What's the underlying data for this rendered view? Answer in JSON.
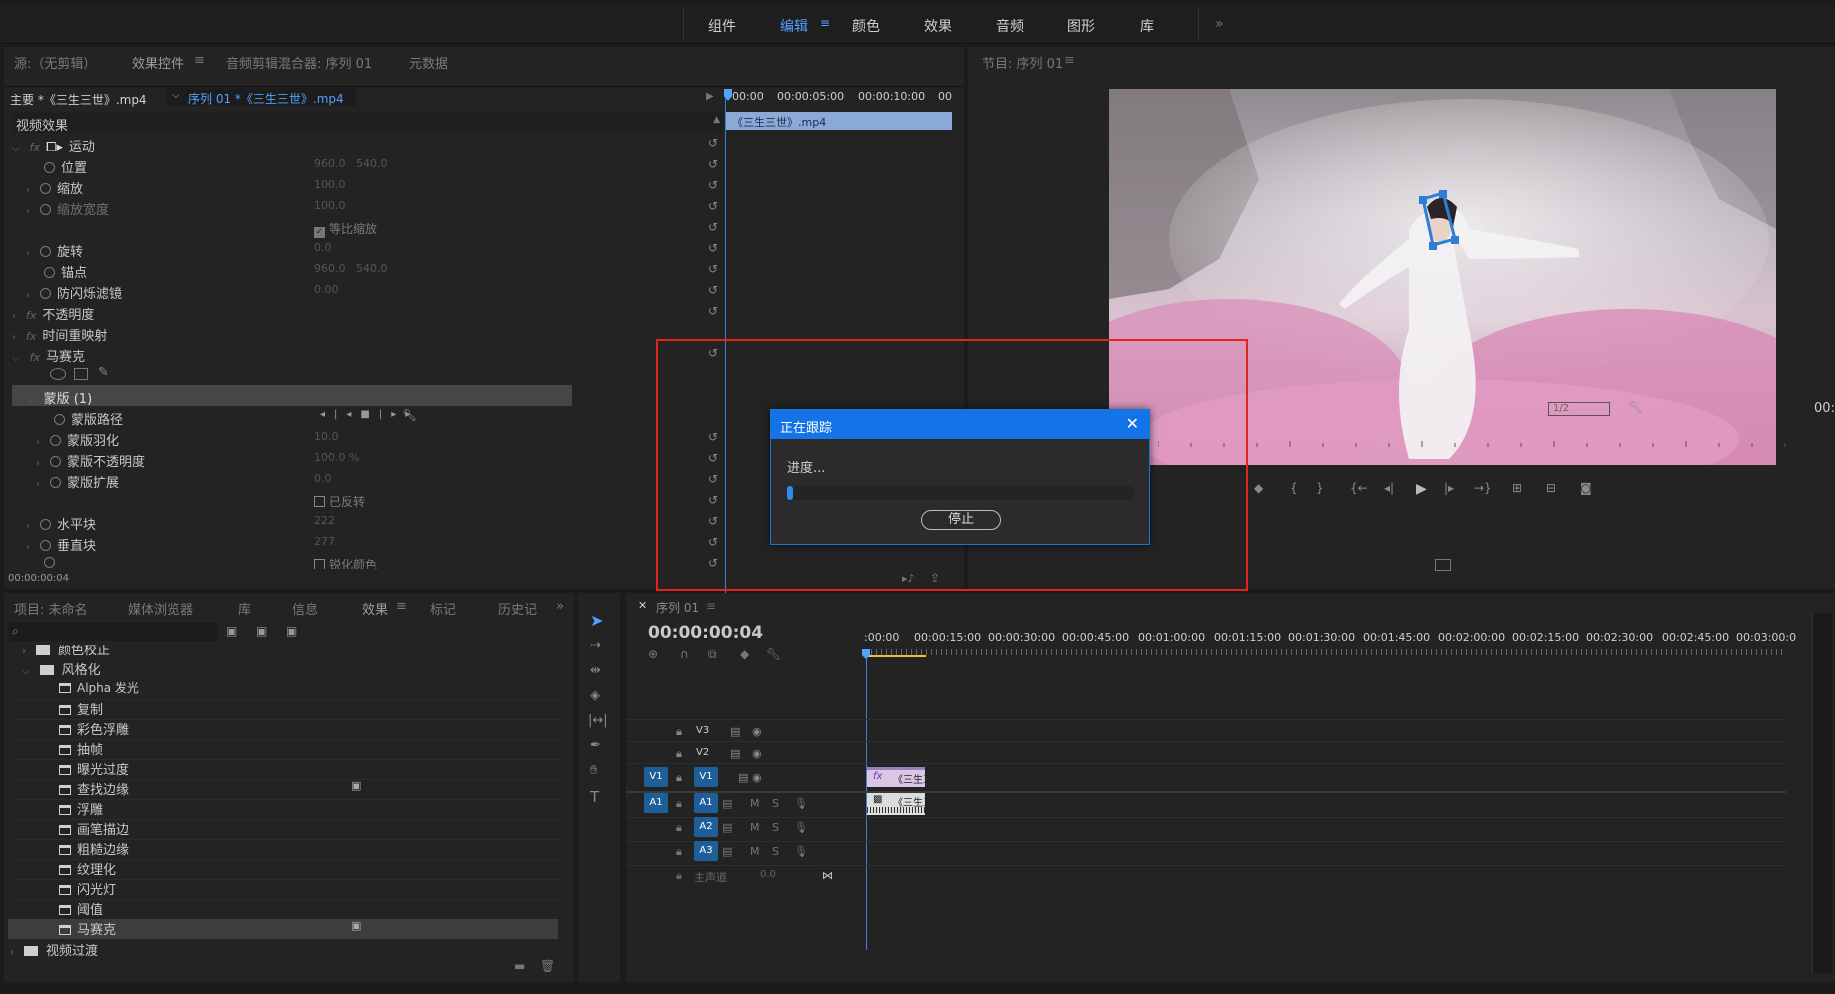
{
  "workspaces": [
    "组件",
    "编辑",
    "颜色",
    "效果",
    "音频",
    "图形",
    "库"
  ],
  "workspace_more": "»",
  "source_panel": {
    "tabs": [
      "源:（无剪辑）",
      "效果控件",
      "音频剪辑混合器: 序列 01",
      "元数据"
    ],
    "active_tab_icon": "≡",
    "clip_master": "主要 *《三生三世》.mp4",
    "clip_sequence": "序列 01 *《三生三世》.mp4",
    "timecodes": [
      "00:00",
      "00:00:05:00",
      "00:00:10:00",
      "00"
    ],
    "clip_bar_label": "《三生三世》.mp4",
    "section_video_effects": "视频效果",
    "motion": "运动",
    "position": "位置",
    "position_x": "960.0",
    "position_y": "540.0",
    "scale": "缩放",
    "scale_val": "100.0",
    "scale_width": "缩放宽度",
    "scale_width_val": "100.0",
    "uniform_scale": "等比缩放",
    "rotation": "旋转",
    "rotation_val": "0.0",
    "anchor": "锚点",
    "anchor_x": "960.0",
    "anchor_y": "540.0",
    "antiflicker": "防闪烁滤镜",
    "antiflicker_val": "0.00",
    "opacity": "不透明度",
    "time_remap": "时间重映射",
    "mosaic": "马赛克",
    "mask": "蒙版 (1)",
    "mask_path": "蒙版路径",
    "mask_feather": "蒙版羽化",
    "mask_feather_val": "10.0",
    "mask_opacity": "蒙版不透明度",
    "mask_opacity_val": "100.0 %",
    "mask_expansion": "蒙版扩展",
    "mask_expansion_val": "0.0",
    "inverted": "已反转",
    "horizontal_blocks": "水平块",
    "horizontal_blocks_val": "222",
    "vertical_blocks": "垂直块",
    "vertical_blocks_val": "277",
    "sharpen_colors": "锐化颜色",
    "current_time": "00:00:00:04"
  },
  "program_panel": {
    "title": "节目: 序列 01",
    "title_icon": "≡",
    "resolution": "1/2",
    "timecode_partial": "00:"
  },
  "project_panel": {
    "tabs": [
      "项目: 未命名",
      "媒体浏览器",
      "库",
      "信息",
      "效果",
      "标记",
      "历史记"
    ],
    "more": "»",
    "partial_item": "颜色校正",
    "folder_stylize": "风格化",
    "items": [
      "Alpha 发光",
      "复制",
      "彩色浮雕",
      "抽帧",
      "曝光过度",
      "查找边缘",
      "浮雕",
      "画笔描边",
      "粗糙边缘",
      "纹理化",
      "闪光灯",
      "阈值",
      "马赛克"
    ],
    "folder_transitions": "视频过渡"
  },
  "timeline": {
    "tab": "序列 01",
    "tab_icon": "≡",
    "timecode": "00:00:00:04",
    "ruler": [
      ":00:00",
      "00:00:15:00",
      "00:00:30:00",
      "00:00:45:00",
      "00:01:00:00",
      "00:01:15:00",
      "00:01:30:00",
      "00:01:45:00",
      "00:02:00:00",
      "00:02:15:00",
      "00:02:30:00",
      "00:02:45:00",
      "00:03:00:0"
    ],
    "tracks_video": [
      "V3",
      "V2",
      "V1"
    ],
    "tracks_audio": [
      "A1",
      "A2",
      "A3"
    ],
    "source_v": "V1",
    "source_a": "A1",
    "master": "主声道",
    "master_val": "0.0",
    "clip_label": "《三生三",
    "mute": "M",
    "solo": "S"
  },
  "dialog": {
    "title": "正在跟踪",
    "close": "✕",
    "progress_label": "进度...",
    "progress": 0.01,
    "stop_button": "停止"
  },
  "colors": {
    "accent": "#1473e6",
    "highlight": "#e0241f",
    "track_blue": "#1f5f99"
  }
}
